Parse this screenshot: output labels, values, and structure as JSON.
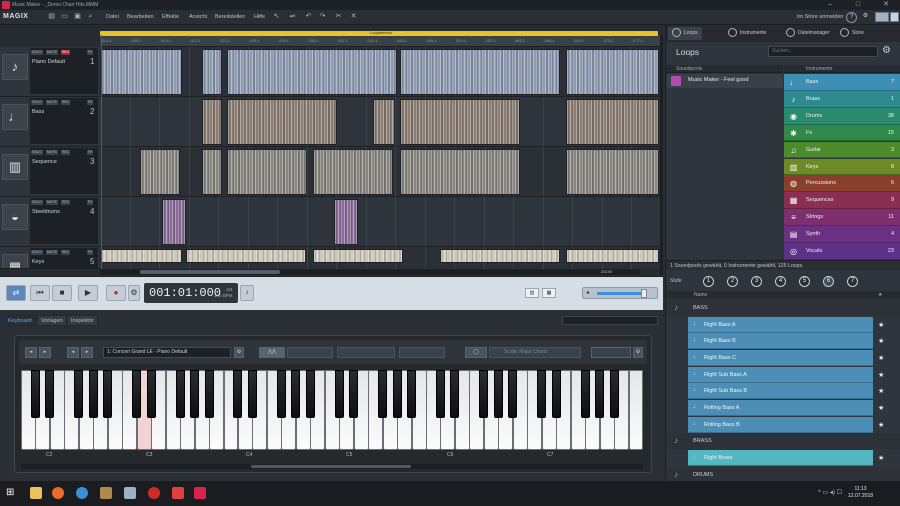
{
  "window": {
    "title": "Music Maker - _Demo Chart Hits.MMM"
  },
  "menu": {
    "logo": "MAGIX",
    "items": [
      "Datei",
      "Bearbeiten",
      "Effekte",
      "Ansicht",
      "Bereitstellen",
      "Hilfe"
    ],
    "store_login": "Im Store anmelden"
  },
  "arranger": {
    "loop_label": "Loopbereich",
    "bar_ticks": [
      "001:1",
      "005:1",
      "009:1",
      "017:1",
      "021:1",
      "025:1",
      "029:1",
      "033:1",
      "037:1",
      "041:1",
      "045:1",
      "049:1",
      "053:1",
      "057:1",
      "061:1",
      "065:1",
      "069:1",
      "073:1",
      "077:1"
    ],
    "track_buttons": {
      "solo": "SOLO",
      "mute": "MUTE",
      "rec": "REC",
      "fx": "FX"
    },
    "tracks": [
      {
        "name": "Piano Default",
        "number": "1",
        "icon": "piano-icon"
      },
      {
        "name": "Bass",
        "number": "2",
        "icon": "bass-guitar-icon"
      },
      {
        "name": "Sequence",
        "number": "3",
        "icon": "synth-icon"
      },
      {
        "name": "Steeldrums",
        "number": "4",
        "icon": "steeldrum-icon"
      },
      {
        "name": "Keys",
        "number": "5",
        "icon": "keyboard-icon"
      }
    ],
    "zoom_label": "Zoom"
  },
  "transport": {
    "time": "001:01:000",
    "tempo_top": "4/4",
    "tempo_bottom": "125 BPM",
    "volume_level": 0.8
  },
  "dock": {
    "tabs": [
      "Keyboard",
      "Vorlagen",
      "Inspektor"
    ],
    "preset": "1: Concert Grand LE - Piano Default",
    "scale": "Scale: Major Chord",
    "octaves": [
      "C2",
      "C3",
      "C4",
      "C5",
      "C6",
      "C7"
    ]
  },
  "right_panel": {
    "tabs": [
      "Loops",
      "Instrumente",
      "Dateimanager",
      "Store"
    ],
    "title": "Loops",
    "search_placeholder": "Suchen...",
    "soundpools_header": "Soundpools",
    "instruments_header": "Instrumente",
    "soundpool": "Music Maker - Feel good",
    "instruments": [
      {
        "name": "Bass",
        "count": "7",
        "color": "#3d8fb6",
        "icon": "bass-icon"
      },
      {
        "name": "Brass",
        "count": "1",
        "color": "#2d8a8f",
        "icon": "trumpet-icon"
      },
      {
        "name": "Drums",
        "count": "38",
        "color": "#2a8a6e",
        "icon": "drums-icon"
      },
      {
        "name": "Fx",
        "count": "15",
        "color": "#2f8a4a",
        "icon": "fx-icon"
      },
      {
        "name": "Guitar",
        "count": "3",
        "color": "#4c8c2c",
        "icon": "guitar-icon"
      },
      {
        "name": "Keys",
        "count": "8",
        "color": "#6d8a26",
        "icon": "keys-icon"
      },
      {
        "name": "Percussions",
        "count": "6",
        "color": "#8a3e2c",
        "icon": "percussion-icon"
      },
      {
        "name": "Sequences",
        "count": "9",
        "color": "#8a2f52",
        "icon": "sequence-icon"
      },
      {
        "name": "Strings",
        "count": "11",
        "color": "#7e2f6f",
        "icon": "strings-icon"
      },
      {
        "name": "Synth",
        "count": "4",
        "color": "#6a3182",
        "icon": "synth-icon"
      },
      {
        "name": "Vocals",
        "count": "23",
        "color": "#5b3288",
        "icon": "vocals-icon"
      }
    ],
    "status": "1 Soundpools gewählt, 0 Instrumente gewählt, 125 Loops.",
    "levels_label": "Stufe",
    "levels": [
      "1",
      "2",
      "3",
      "4",
      "5",
      "6",
      "7"
    ],
    "active_level": "6",
    "list_header": "Name",
    "list": [
      {
        "type": "category",
        "name": "BASS"
      },
      {
        "type": "loop",
        "name": "Right Bass A"
      },
      {
        "type": "loop",
        "name": "Right Bass B"
      },
      {
        "type": "loop",
        "name": "Right Bass C"
      },
      {
        "type": "loop",
        "name": "Right Sub Bass A"
      },
      {
        "type": "loop",
        "name": "Right Sub Bass B"
      },
      {
        "type": "loop",
        "name": "Rolling Bass A"
      },
      {
        "type": "loop",
        "name": "Rolling Bass B"
      },
      {
        "type": "category",
        "name": "BRASS"
      },
      {
        "type": "loop",
        "name": "Right Brass",
        "selected": true
      },
      {
        "type": "category",
        "name": "DRUMS"
      }
    ]
  },
  "taskbar": {
    "time": "11:13",
    "date": "12.07.2018"
  }
}
